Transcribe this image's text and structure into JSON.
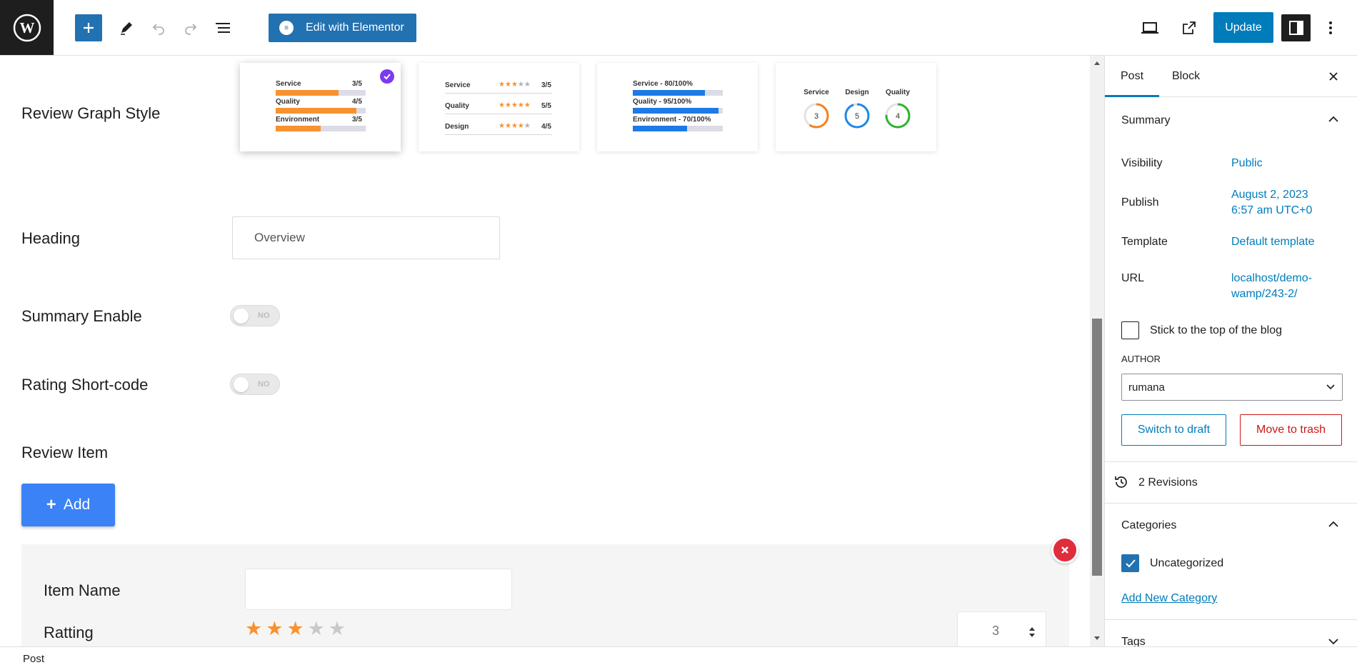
{
  "topbar": {
    "elementor_label": "Edit with Elementor",
    "update_label": "Update",
    "icons": [
      "wordpress-icon",
      "plus-icon",
      "pencil-icon",
      "undo-icon",
      "redo-icon",
      "list-view-icon",
      "laptop-icon",
      "external-link-icon",
      "sidebar-icon",
      "more-vertical-icon"
    ],
    "accent": "#2271b1"
  },
  "main": {
    "graph_style_label": "Review Graph Style",
    "graph_styles": [
      {
        "type": "bars",
        "selected": true,
        "rows": [
          {
            "label": "Service",
            "value": "3/5",
            "fill": 0.7
          },
          {
            "label": "Quality",
            "value": "4/5",
            "fill": 0.9
          },
          {
            "label": "Environment",
            "value": "3/5",
            "fill": 0.5
          }
        ]
      },
      {
        "type": "stars",
        "rows": [
          {
            "label": "Service",
            "value": "3/5",
            "stars": 3
          },
          {
            "label": "Quality",
            "value": "5/5",
            "stars": 5
          },
          {
            "label": "Design",
            "value": "4/5",
            "stars": 4
          }
        ]
      },
      {
        "type": "percent",
        "rows": [
          {
            "label": "Service - 80/100%",
            "fill": 0.8
          },
          {
            "label": "Quality - 95/100%",
            "fill": 0.95
          },
          {
            "label": "Environment - 70/100%",
            "fill": 0.6
          }
        ]
      },
      {
        "type": "rings",
        "rings": [
          {
            "label": "Service",
            "value": "3",
            "color": "#f58220"
          },
          {
            "label": "Design",
            "value": "5",
            "color": "#1e88e5"
          },
          {
            "label": "Quality",
            "value": "4",
            "color": "#2bb52b"
          }
        ]
      }
    ],
    "heading_label": "Heading",
    "heading_value": "Overview",
    "summary_label": "Summary Enable",
    "summary_toggle": "NO",
    "shortcode_label": "Rating Short-code",
    "shortcode_toggle": "NO",
    "review_item_label": "Review Item",
    "add_label": "Add",
    "item": {
      "name_label": "Item Name",
      "name_value": "",
      "rating_label": "Ratting",
      "rating_stars": 3,
      "rating_max": 5,
      "rating_value": "3"
    }
  },
  "sidebar": {
    "tabs": [
      "Post",
      "Block"
    ],
    "summary_title": "Summary",
    "visibility_label": "Visibility",
    "visibility_value": "Public",
    "publish_label": "Publish",
    "publish_line1": "August 2, 2023",
    "publish_line2": "6:57 am UTC+0",
    "template_label": "Template",
    "template_value": "Default template",
    "url_label": "URL",
    "url_line1": "localhost/demo-",
    "url_line2": "wamp/243-2/",
    "sticky_label": "Stick to the top of the blog",
    "author_label": "AUTHOR",
    "author_value": "rumana",
    "draft_label": "Switch to draft",
    "trash_label": "Move to trash",
    "revisions_label": "2 Revisions",
    "categories_title": "Categories",
    "category_item": "Uncategorized",
    "add_category_label": "Add New Category",
    "tags_title": "Tags"
  },
  "footer": {
    "breadcrumb": "Post"
  }
}
